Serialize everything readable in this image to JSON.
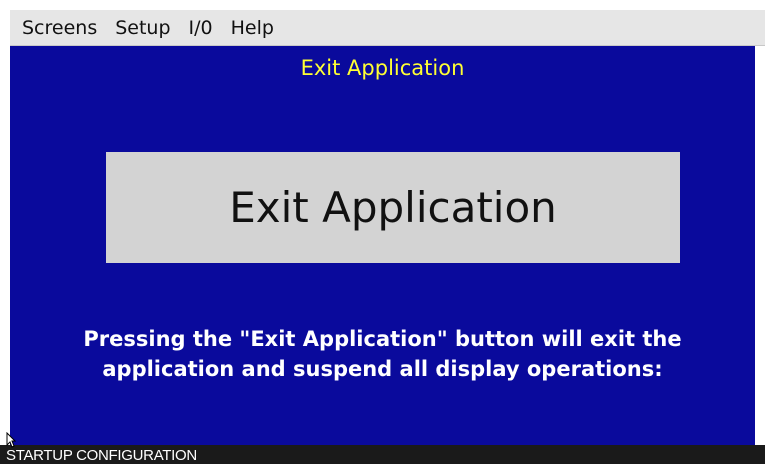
{
  "menubar": {
    "items": [
      {
        "label": "Screens"
      },
      {
        "label": "Setup"
      },
      {
        "label": "I/0"
      },
      {
        "label": "Help"
      }
    ]
  },
  "screen": {
    "title": "Exit Application",
    "button_label": "Exit Application",
    "info_lines": [
      "Pressing the \"Exit Application\" button will exit the",
      "application and suspend all display operations:"
    ]
  },
  "statusbar": {
    "text": "STARTUP CONFIGURATION"
  },
  "colors": {
    "screen_background": "#0a0a9c",
    "title_text": "#ffff33",
    "button_background": "#d3d3d3",
    "info_text": "#ffffff",
    "menubar_background": "#e6e6e6",
    "statusbar_background": "#1a1a1a"
  },
  "icons": {
    "cursor": "mouse-pointer-icon"
  }
}
